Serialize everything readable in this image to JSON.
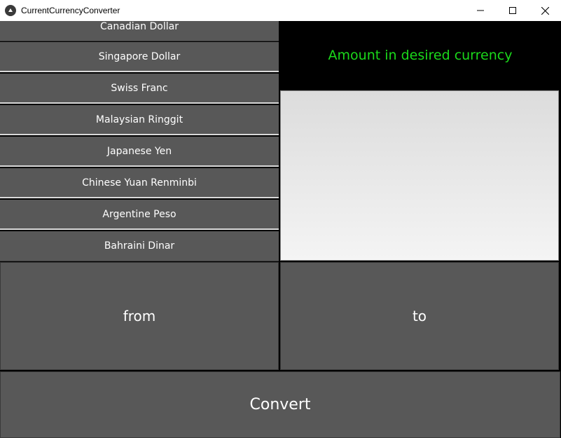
{
  "window": {
    "title": "CurrentCurrencyConverter",
    "controls": [
      "minimize",
      "maximize",
      "close"
    ]
  },
  "currencies": [
    "Canadian Dollar",
    "Singapore Dollar",
    "Swiss Franc",
    "Malaysian Ringgit",
    "Japanese Yen",
    "Chinese Yuan Renminbi",
    "Argentine Peso",
    "Bahraini Dinar"
  ],
  "result": {
    "label": "Amount in desired currency",
    "value": ""
  },
  "buttons": {
    "from": "from",
    "to": "to",
    "convert": "Convert"
  },
  "colors": {
    "button_bg": "#585858",
    "result_text": "#1bd91b",
    "background": "#000000"
  },
  "icons": {
    "app": "kivy-app-icon",
    "minimize": "minimize-icon",
    "maximize": "maximize-icon",
    "close": "close-icon"
  }
}
